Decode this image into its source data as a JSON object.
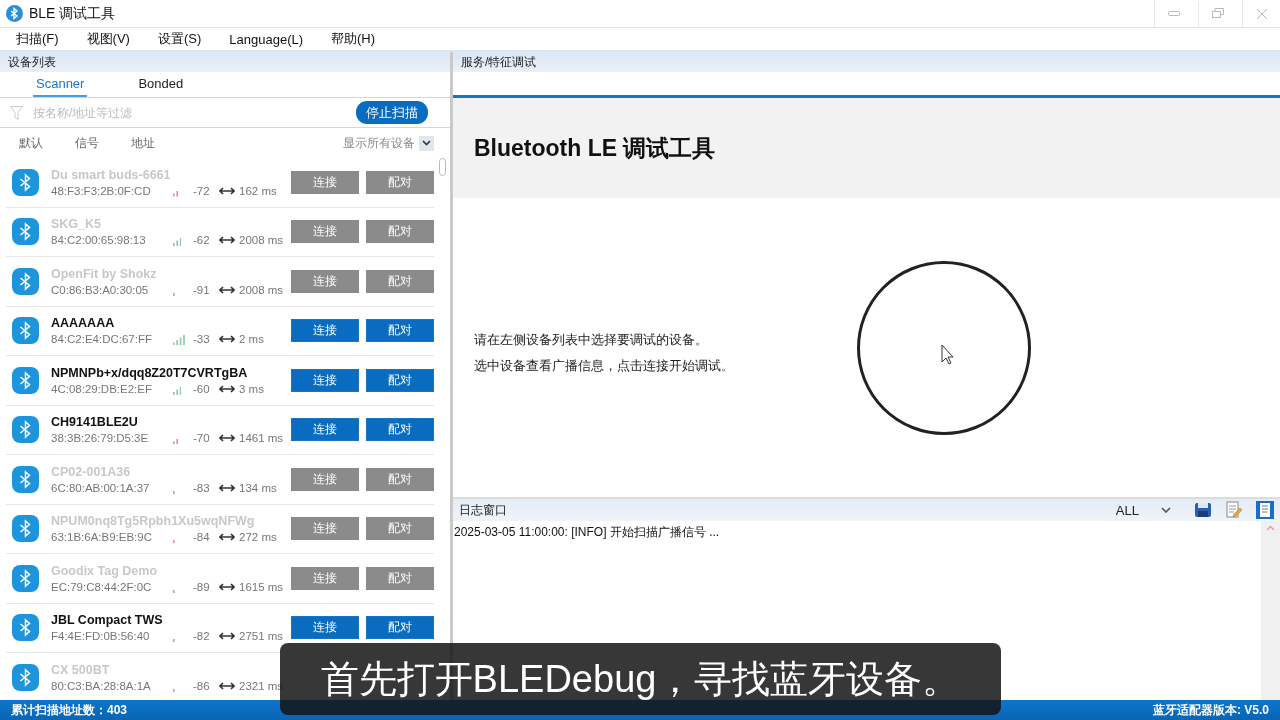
{
  "window": {
    "title": "BLE 调试工具"
  },
  "menu": [
    "扫描(F)",
    "视图(V)",
    "设置(S)",
    "Language(L)",
    "帮助(H)"
  ],
  "device_panel": {
    "title": "设备列表",
    "tabs": [
      {
        "label": "Scanner",
        "selected": true
      },
      {
        "label": "Bonded",
        "selected": false
      }
    ],
    "filter": {
      "placeholder": "按名称/地址等过滤"
    },
    "scan_button": "停止扫描",
    "sort_options": [
      "默认",
      "信号",
      "地址"
    ],
    "show_filter": "显示所有设备",
    "devices": [
      {
        "name": "Du smart buds-6661",
        "address": "48:F3:F3:2B:0F:CD",
        "rssi": "-72",
        "interval": "162 ms",
        "kind": "mid",
        "disabled": true,
        "connect": "连接",
        "pair": "配对"
      },
      {
        "name": "SKG_K5",
        "address": "84:C2:00:65:98:13",
        "rssi": "-62",
        "interval": "2008 ms",
        "kind": "high",
        "disabled": true,
        "connect": "连接",
        "pair": "配对"
      },
      {
        "name": "OpenFit by Shokz",
        "address": "C0:86:B3:A0:30:05",
        "rssi": "-91",
        "interval": "2008 ms",
        "kind": "low",
        "disabled": true,
        "connect": "连接",
        "pair": "配对"
      },
      {
        "name": "AAAAAAA",
        "address": "84:C2:E4:DC:67:FF",
        "rssi": "-33",
        "interval": "2 ms",
        "kind": "full",
        "disabled": false,
        "connect": "连接",
        "pair": "配对"
      },
      {
        "name": "NPMNPb+x/dqq8Z20T7CVRTgBA",
        "address": "4C:08:29:DB:E2:EF",
        "rssi": "-60",
        "interval": "3 ms",
        "kind": "high",
        "disabled": false,
        "connect": "连接",
        "pair": "配对"
      },
      {
        "name": "CH9141BLE2U",
        "address": "38:3B:26:79:D5:3E",
        "rssi": "-70",
        "interval": "1461 ms",
        "kind": "mid",
        "disabled": false,
        "connect": "连接",
        "pair": "配对"
      },
      {
        "name": "CP02-001A36",
        "address": "6C:80:AB:00:1A:37",
        "rssi": "-83",
        "interval": "134 ms",
        "kind": "low",
        "disabled": true,
        "connect": "连接",
        "pair": "配对"
      },
      {
        "name": "NPUM0nq8Tg5Rpbh1Xu5wqNFWg",
        "address": "63:1B:6A:B9:EB:9C",
        "rssi": "-84",
        "interval": "272 ms",
        "kind": "low",
        "disabled": true,
        "connect": "连接",
        "pair": "配对"
      },
      {
        "name": "Goodix Tag Demo",
        "address": "EC:79:C8:44:2F:0C",
        "rssi": "-89",
        "interval": "1615 ms",
        "kind": "low",
        "disabled": true,
        "connect": "连接",
        "pair": "配对"
      },
      {
        "name": "JBL Compact TWS",
        "address": "F4:4E:FD:0B:56:40",
        "rssi": "-82",
        "interval": "2751 ms",
        "kind": "low",
        "disabled": false,
        "connect": "连接",
        "pair": "配对"
      },
      {
        "name": "CX 500BT",
        "address": "80:C3:BA:28:8A:1A",
        "rssi": "-86",
        "interval": "2321 ms",
        "kind": "low",
        "disabled": true
      }
    ]
  },
  "service_panel": {
    "title": "服务/特征调试",
    "heading": "Bluetooth LE 调试工具",
    "hint_lines": [
      "请在左侧设备列表中选择要调试的设备。",
      "选中设备查看广播信息，点击连接开始调试。"
    ]
  },
  "log_panel": {
    "title": "日志窗口",
    "level": "ALL",
    "lines": [
      "2025-03-05 11:00:00:  [INFO] 开始扫描广播信号 ..."
    ]
  },
  "status_bar": {
    "left": "累计扫描地址数：403",
    "right": "蓝牙适配器版本: V5.0"
  },
  "caption": "首先打开BLEDebug，寻找蓝牙设备。"
}
